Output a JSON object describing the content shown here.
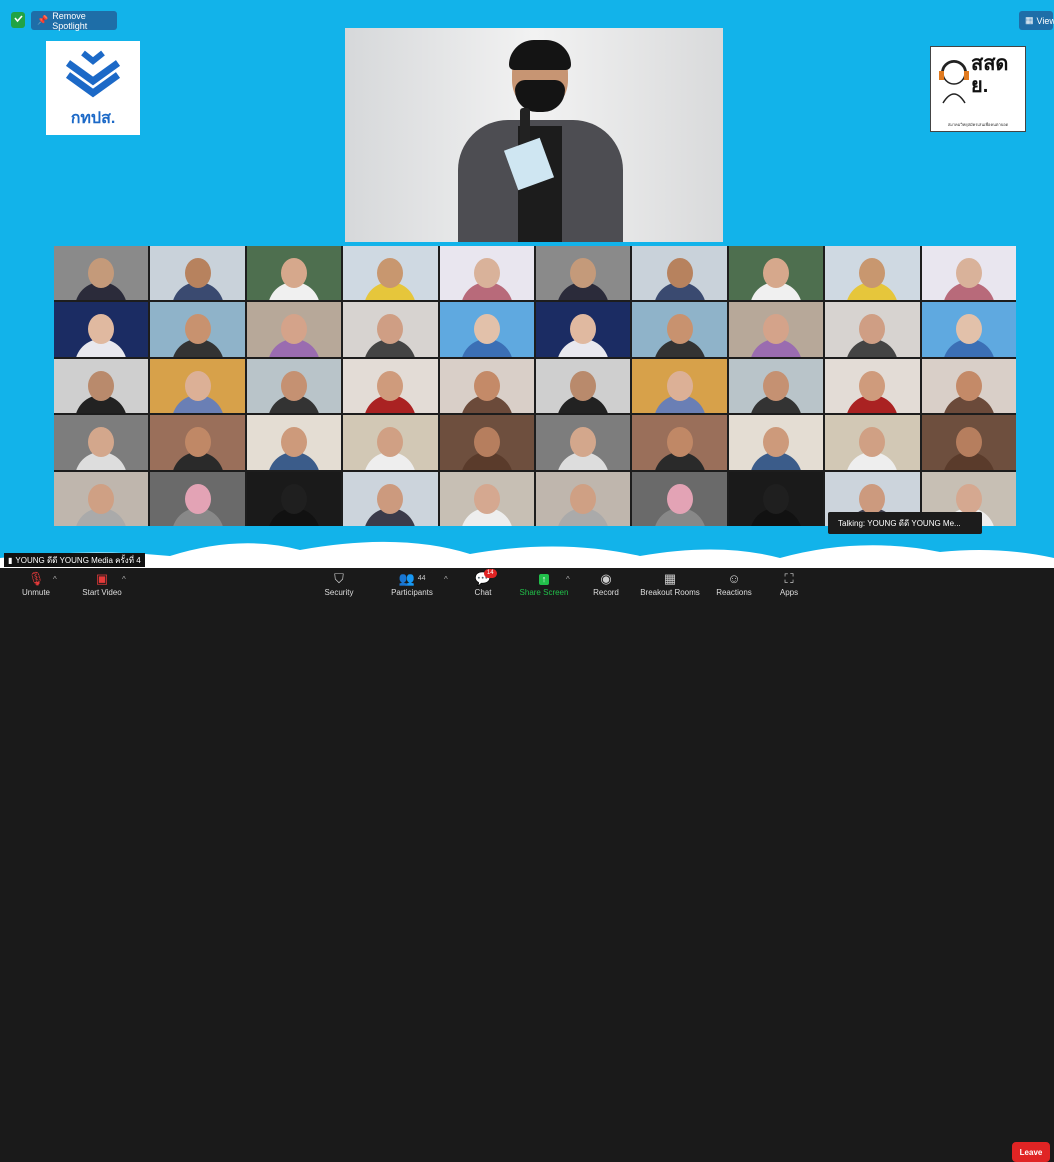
{
  "top": {
    "remove_spotlight": "Remove Spotlight",
    "view_label": "View"
  },
  "logos": {
    "left_text": "กทปส.",
    "right_text": "สสดย.",
    "right_subtitle": "สมาคมวิทยุสมัครเล่นเพื่อคนตาบอด"
  },
  "gallery": {
    "tiles": [
      {
        "skin": "#c49a7a",
        "shirt": "#2b2b3a",
        "bg": "#8a8a8a"
      },
      {
        "skin": "#b7825e",
        "shirt": "#3a4a70",
        "bg": "#c9d2da"
      },
      {
        "skin": "#d6a88c",
        "shirt": "#f0f0f0",
        "bg": "#4e6f4f"
      },
      {
        "skin": "#c8976f",
        "shirt": "#e6c63b",
        "bg": "#cfd9e2"
      },
      {
        "skin": "#d9b29a",
        "shirt": "#b86a7a",
        "bg": "#e9e6ef"
      },
      {
        "skin": "#c49a7a",
        "shirt": "#2b2b3a",
        "bg": "#8a8a8a"
      },
      {
        "skin": "#b7825e",
        "shirt": "#3a4a70",
        "bg": "#c9d2da"
      },
      {
        "skin": "#d6a88c",
        "shirt": "#f0f0f0",
        "bg": "#4e6f4f"
      },
      {
        "skin": "#c8976f",
        "shirt": "#e6c63b",
        "bg": "#cfd9e2"
      },
      {
        "skin": "#d9b29a",
        "shirt": "#b86a7a",
        "bg": "#e9e6ef"
      },
      {
        "skin": "#e0b9a0",
        "shirt": "#e8e8ee",
        "bg": "#1b2c63"
      },
      {
        "skin": "#c8926f",
        "shirt": "#333",
        "bg": "#8fb3c9"
      },
      {
        "skin": "#d4a38a",
        "shirt": "#9a6cb0",
        "bg": "#b7a899"
      },
      {
        "skin": "#cf9e84",
        "shirt": "#444",
        "bg": "#d7d3d0"
      },
      {
        "skin": "#e2c1aa",
        "shirt": "#3b6fb5",
        "bg": "#5fa9e0"
      },
      {
        "skin": "#e0b9a0",
        "shirt": "#e8e8ee",
        "bg": "#1b2c63"
      },
      {
        "skin": "#c8926f",
        "shirt": "#333",
        "bg": "#8fb3c9"
      },
      {
        "skin": "#d4a38a",
        "shirt": "#9a6cb0",
        "bg": "#b7a899"
      },
      {
        "skin": "#cf9e84",
        "shirt": "#444",
        "bg": "#d7d3d0"
      },
      {
        "skin": "#e2c1aa",
        "shirt": "#3b6fb5",
        "bg": "#5fa9e0"
      },
      {
        "skin": "#b98a6c",
        "shirt": "#222",
        "bg": "#cfcfcf"
      },
      {
        "skin": "#dcb096",
        "shirt": "#6a7fb5",
        "bg": "#d7a14a"
      },
      {
        "skin": "#c59172",
        "shirt": "#333",
        "bg": "#b9c4c9"
      },
      {
        "skin": "#cf9b7c",
        "shirt": "#a22",
        "bg": "#e3dcd6"
      },
      {
        "skin": "#c48a68",
        "shirt": "#6b4a3a",
        "bg": "#d9cfc8"
      },
      {
        "skin": "#b98a6c",
        "shirt": "#222",
        "bg": "#cfcfcf"
      },
      {
        "skin": "#dcb096",
        "shirt": "#6a7fb5",
        "bg": "#d7a14a"
      },
      {
        "skin": "#c59172",
        "shirt": "#333",
        "bg": "#b9c4c9"
      },
      {
        "skin": "#cf9b7c",
        "shirt": "#a22",
        "bg": "#e3dcd6"
      },
      {
        "skin": "#c48a68",
        "shirt": "#6b4a3a",
        "bg": "#d9cfc8"
      },
      {
        "skin": "#d3a78c",
        "shirt": "#ddd",
        "bg": "#7d7d7d"
      },
      {
        "skin": "#c08866",
        "shirt": "#2a2a2a",
        "bg": "#9a6f5a"
      },
      {
        "skin": "#cd9a7b",
        "shirt": "#3b5c8a",
        "bg": "#e4ddd3"
      },
      {
        "skin": "#d0a084",
        "shirt": "#eee",
        "bg": "#d2c8b5"
      },
      {
        "skin": "#b67e5e",
        "shirt": "#5a3b2b",
        "bg": "#6e4f3e"
      },
      {
        "skin": "#d3a78c",
        "shirt": "#ddd",
        "bg": "#7d7d7d"
      },
      {
        "skin": "#c08866",
        "shirt": "#2a2a2a",
        "bg": "#9a6f5a"
      },
      {
        "skin": "#cd9a7b",
        "shirt": "#3b5c8a",
        "bg": "#e4ddd3"
      },
      {
        "skin": "#d0a084",
        "shirt": "#eee",
        "bg": "#d2c8b5"
      },
      {
        "skin": "#b67e5e",
        "shirt": "#5a3b2b",
        "bg": "#6e4f3e"
      },
      {
        "skin": "#cfa084",
        "shirt": "#aaa",
        "bg": "#bfb6ad"
      },
      {
        "skin": "#e3a3b5",
        "shirt": "#888",
        "bg": "#6a6a6a"
      },
      {
        "skin": "#1f1f1f",
        "shirt": "#111",
        "bg": "#1a1a1a"
      },
      {
        "skin": "#cc9a7e",
        "shirt": "#3b3b4a",
        "bg": "#ccd4dc"
      },
      {
        "skin": "#d5a890",
        "shirt": "#eee",
        "bg": "#c7bfb4"
      },
      {
        "skin": "#cfa084",
        "shirt": "#aaa",
        "bg": "#bfb6ad"
      },
      {
        "skin": "#e3a3b5",
        "shirt": "#888",
        "bg": "#6a6a6a"
      },
      {
        "skin": "#1f1f1f",
        "shirt": "#111",
        "bg": "#1a1a1a"
      },
      {
        "skin": "#cc9a7e",
        "shirt": "#3b3b4a",
        "bg": "#ccd4dc"
      },
      {
        "skin": "#d5a890",
        "shirt": "#eee",
        "bg": "#c7bfb4"
      }
    ]
  },
  "talking": "Talking:  YOUNG ดีดี YOUNG  Me...",
  "self_name": "YOUNG ดีดี YOUNG Media ครั้งที่ 4",
  "toolbar": {
    "unmute": "Unmute",
    "start_video": "Start Video",
    "security": "Security",
    "participants": "Participants",
    "participants_count": "44",
    "chat": "Chat",
    "chat_badge": "14",
    "share_screen": "Share Screen",
    "record": "Record",
    "breakout_rooms": "Breakout Rooms",
    "reactions": "Reactions",
    "apps": "Apps",
    "leave": "Leave"
  },
  "colors": {
    "stage_bg": "#12b3ea",
    "share_green": "#21c04a",
    "leave_red": "#e02424"
  }
}
